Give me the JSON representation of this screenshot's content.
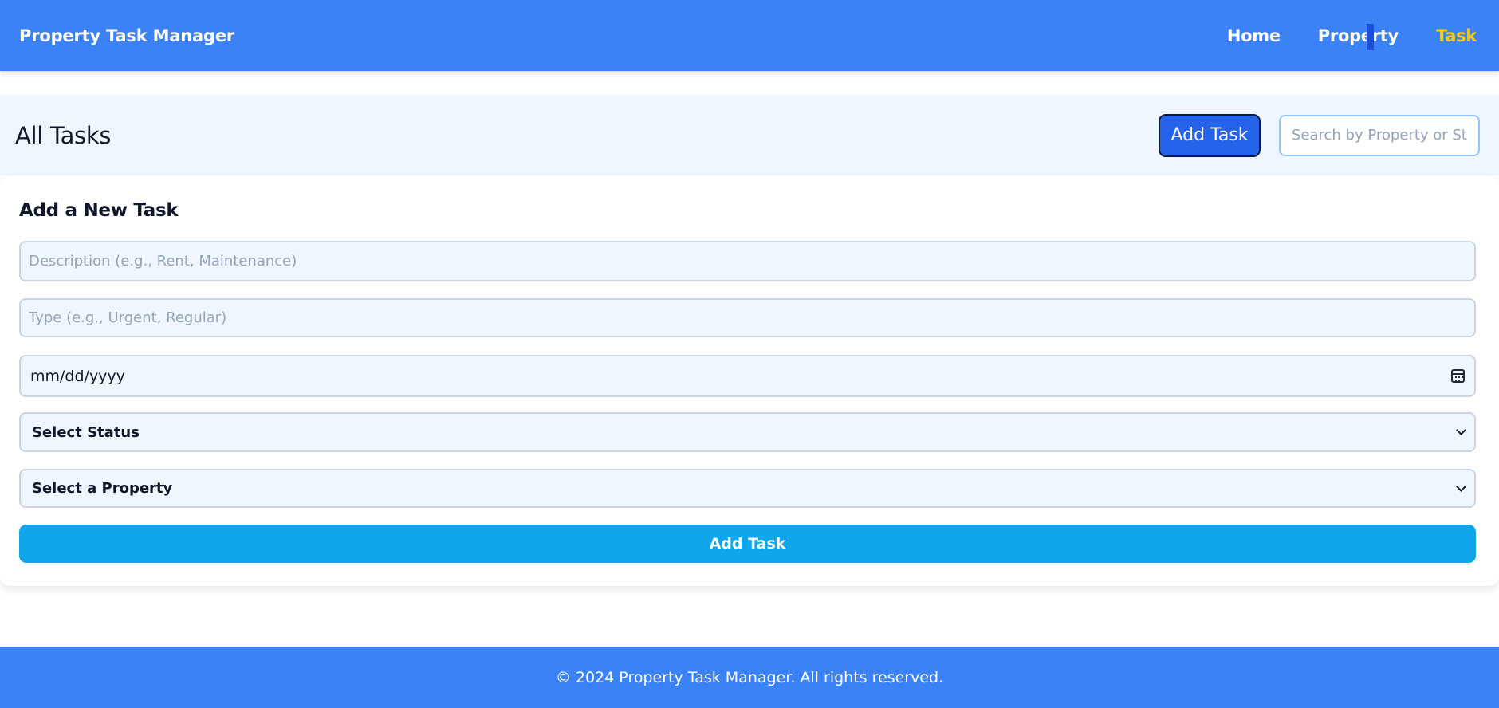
{
  "header": {
    "brand": "Property Task Manager",
    "nav": [
      {
        "label": "Home"
      },
      {
        "label": "Property"
      },
      {
        "label": "Task"
      }
    ],
    "colors": {
      "background": "#3b82f6",
      "active": "#facc15"
    }
  },
  "toolbar": {
    "title": "All Tasks",
    "add_button_label": "Add Task",
    "search_placeholder": "Search by Property or Status"
  },
  "form": {
    "title": "Add a New Task",
    "description_placeholder": "Description (e.g., Rent, Maintenance)",
    "type_placeholder": "Type (e.g., Urgent, Regular)",
    "date_value": "mm/dd/yyyy",
    "date_icon": "calendar-icon",
    "status_select": "Select Status",
    "property_select": "Select a Property",
    "submit_label": "Add Task"
  },
  "footer": {
    "text": "© 2024 Property Task Manager. All rights reserved."
  }
}
